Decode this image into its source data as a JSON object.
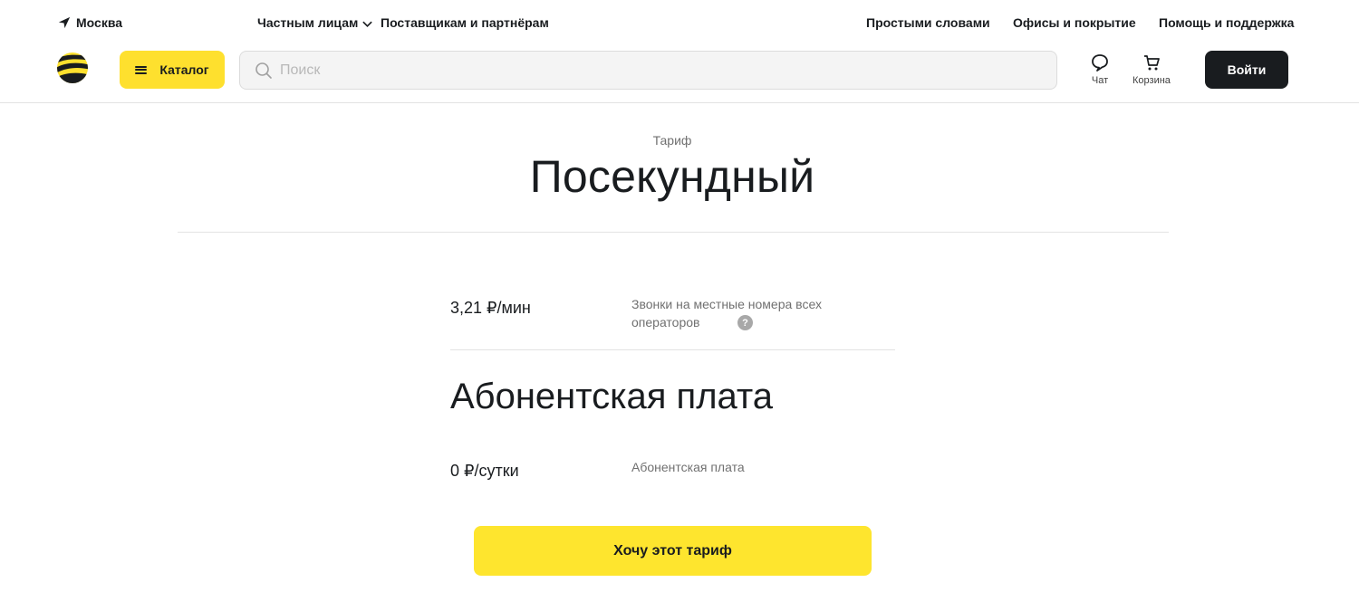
{
  "topbar": {
    "city": "Москва",
    "segments": [
      "Частным лицам",
      "Поставщикам и партнёрам"
    ],
    "links": [
      "Простыми словами",
      "Офисы и покрытие",
      "Помощь и поддержка"
    ]
  },
  "header": {
    "catalog_label": "Каталог",
    "search_placeholder": "Поиск",
    "chat_label": "Чат",
    "cart_label": "Корзина",
    "login_label": "Войти"
  },
  "tariff": {
    "eyebrow": "Тариф",
    "name": "Посекундный",
    "call_price": "3,21 ₽/мин",
    "call_desc": "Звонки на местные номера всех операторов",
    "fee_section_title": "Абонентская плата",
    "fee_price": "0 ₽/сутки",
    "fee_desc": "Абонентская плата",
    "cta_label": "Хочу этот тариф"
  },
  "colors": {
    "brand_yellow": "#fee02e",
    "dark": "#191c1f",
    "muted_text": "#707070"
  },
  "icons": {
    "city": "location-arrow-icon",
    "search": "search-icon",
    "chat": "chat-bubble-icon",
    "cart": "cart-icon",
    "help": "question-icon"
  }
}
